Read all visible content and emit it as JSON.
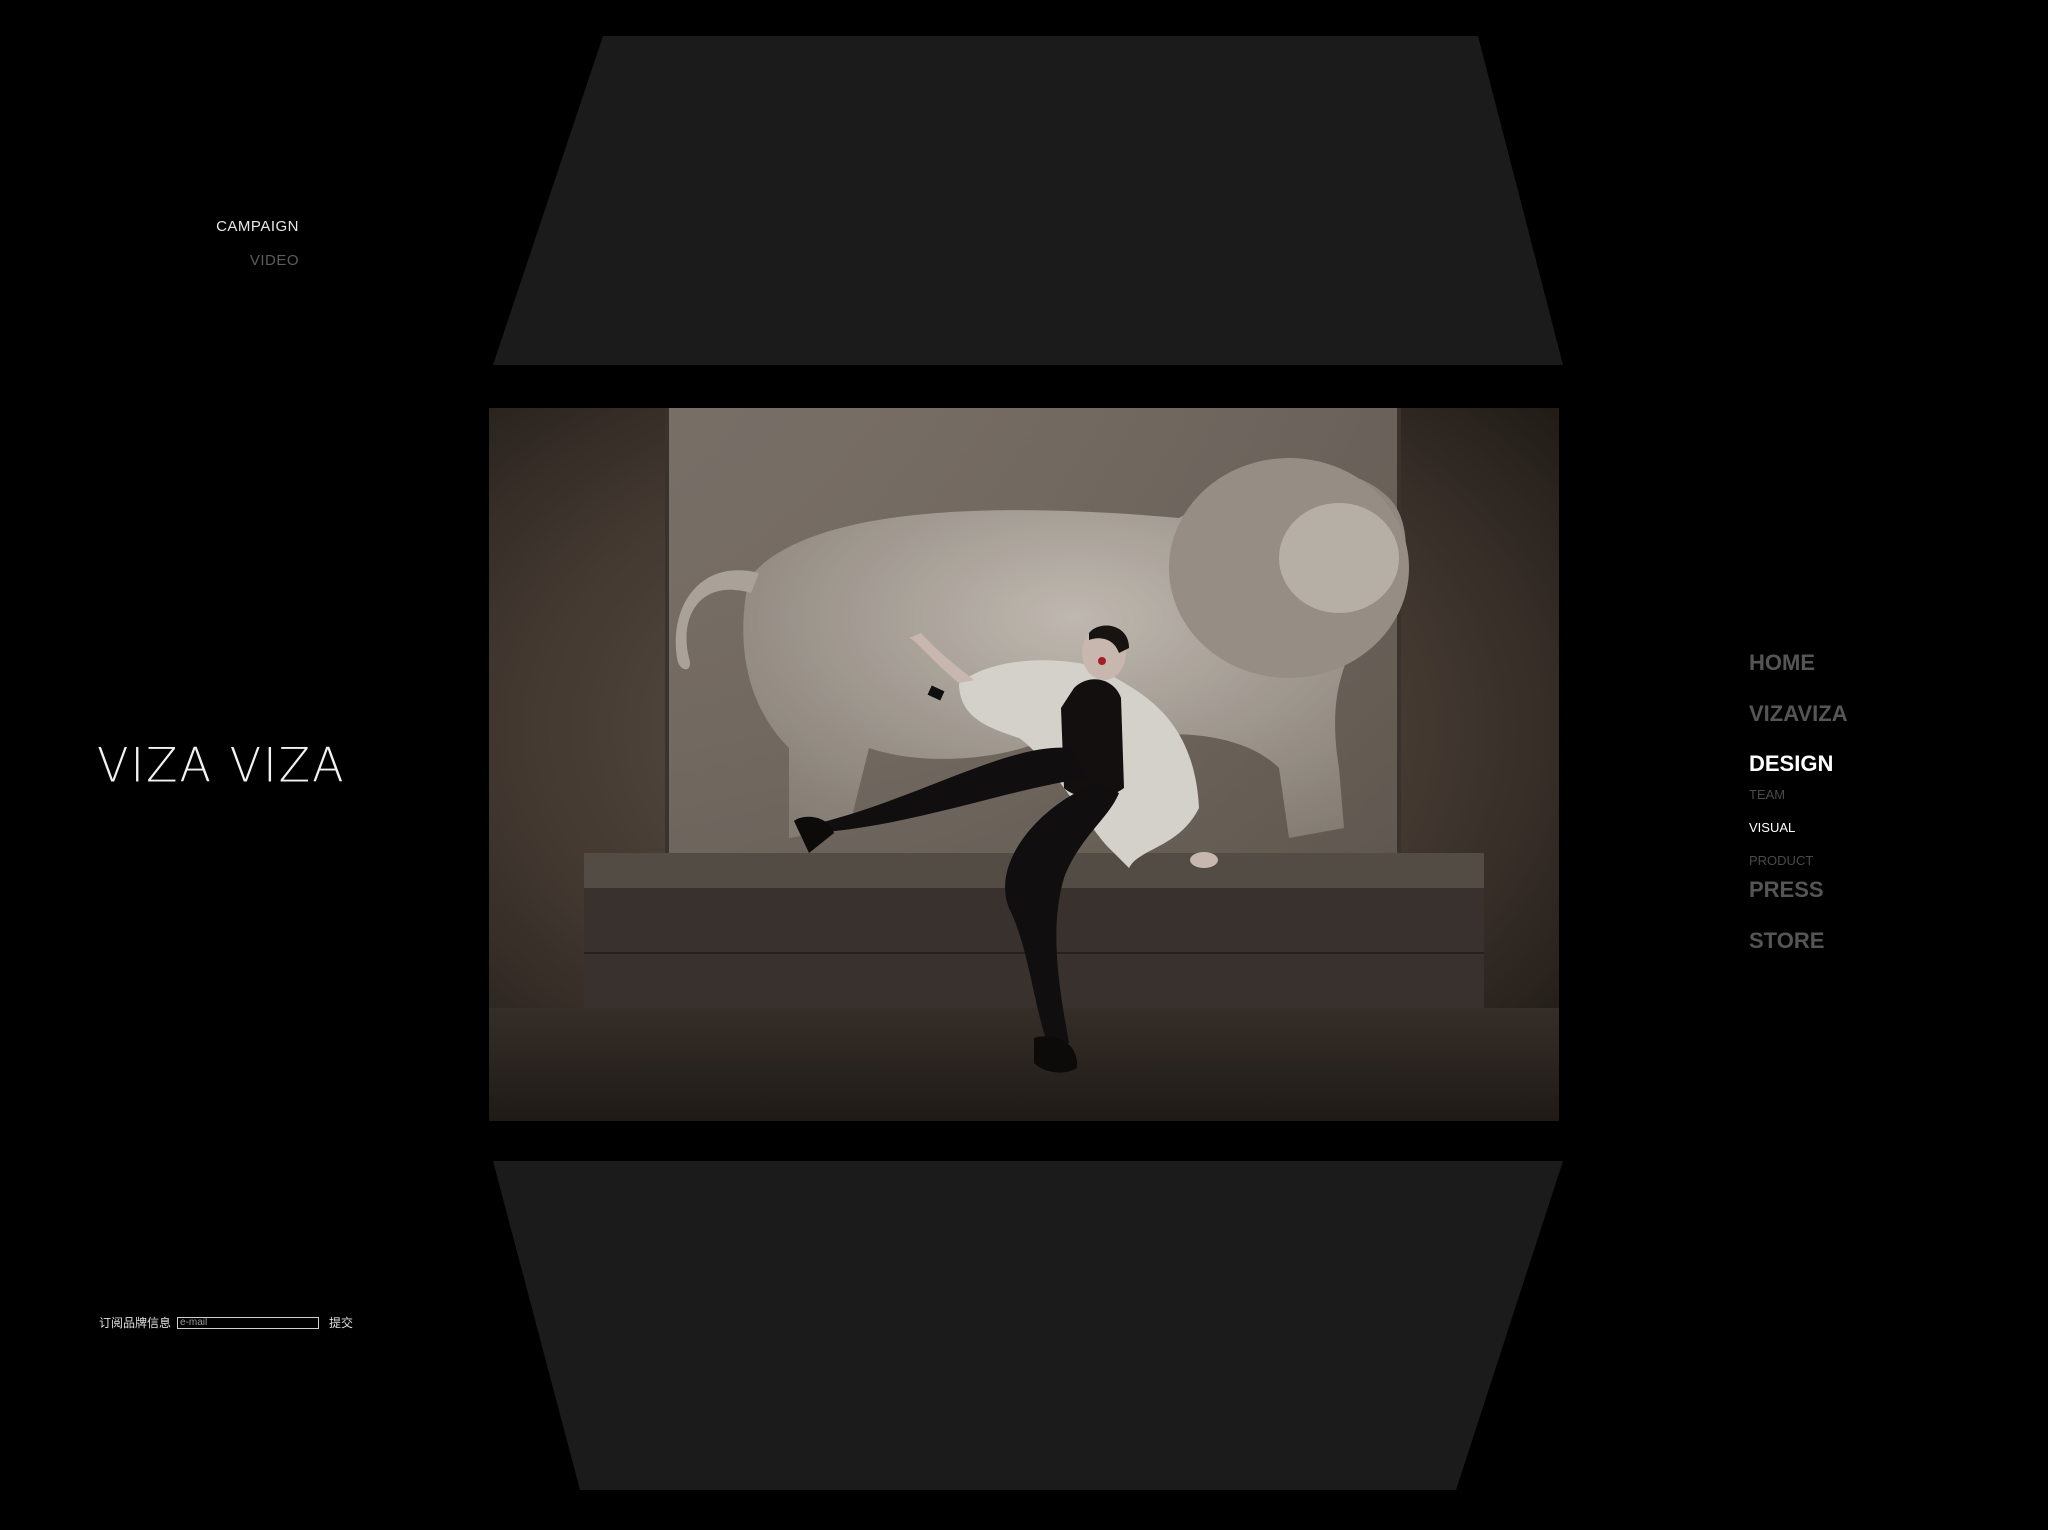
{
  "brand": {
    "logo_text": "VIZA VIZA"
  },
  "sub_nav": {
    "items": [
      {
        "label": "CAMPAIGN",
        "active": true
      },
      {
        "label": "VIDEO",
        "active": false
      }
    ]
  },
  "main_nav": {
    "home": "HOME",
    "vizaviza": "VIZAVIZA",
    "design": "DESIGN",
    "design_sub": {
      "team": "TEAM",
      "visual": "VISUAL",
      "product": "PRODUCT"
    },
    "press": "PRESS",
    "store": "STORE",
    "active_section": "DESIGN",
    "active_subsection": "VISUAL"
  },
  "subscribe": {
    "label": "订阅品牌信息",
    "placeholder": "e-mail",
    "value": "",
    "submit_label": "提交"
  },
  "gallery": {
    "image_alt": "Campaign photo",
    "panel_color": "#1b1b1b"
  },
  "colors": {
    "background": "#000000",
    "active_text": "#ffffff",
    "inactive_text": "#555555"
  }
}
